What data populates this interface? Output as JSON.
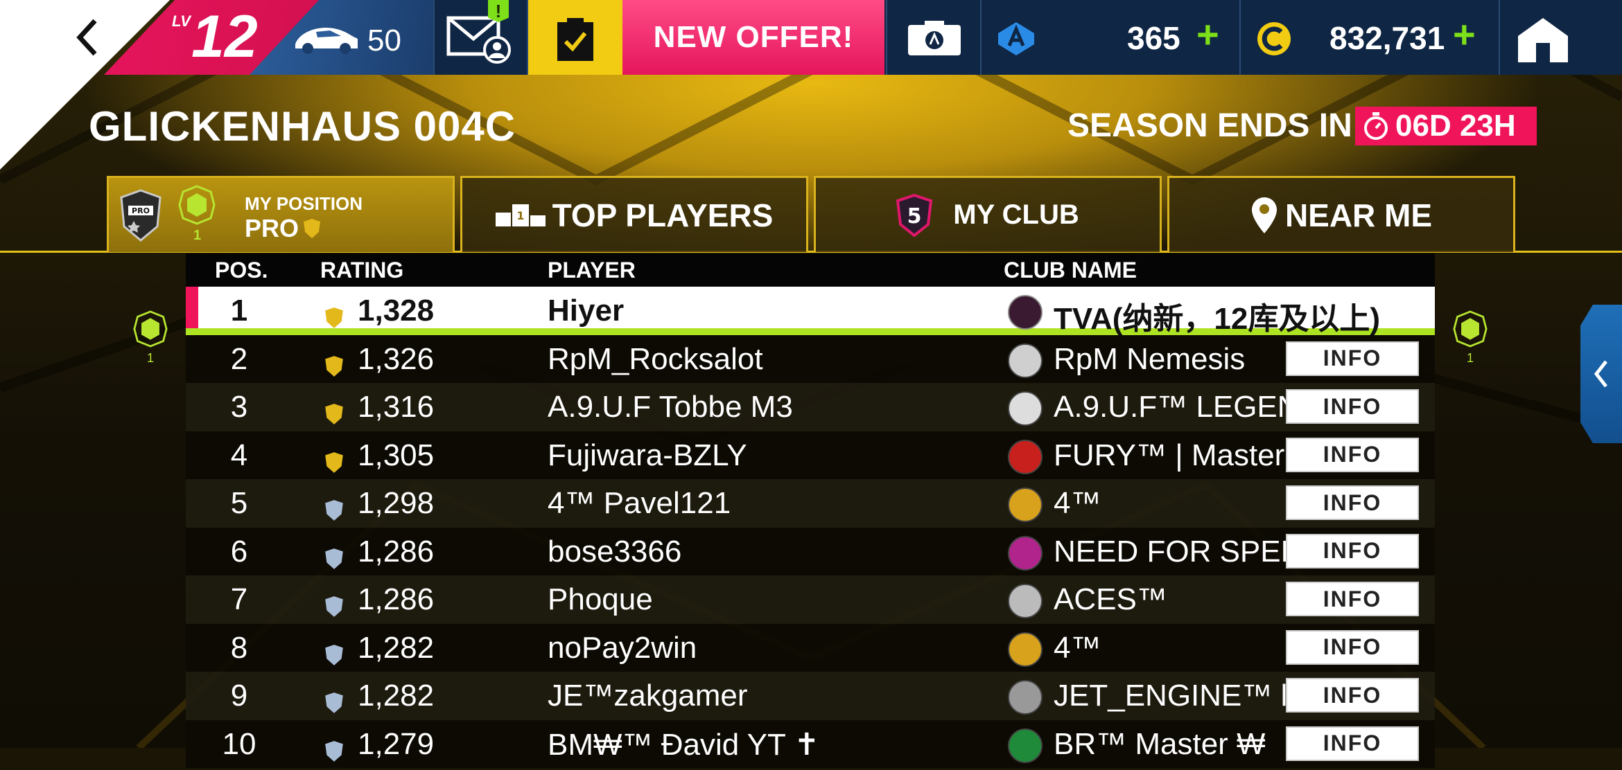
{
  "topbar": {
    "level_label": "LV",
    "level": "12",
    "cars_count": "50",
    "new_offer": "NEW OFFER!",
    "tokens": "365",
    "credits": "832,731",
    "mail_badge": "!"
  },
  "header": {
    "title": "GLICKENHAUS 004C",
    "season_label": "SEASON ENDS IN",
    "season_timer": "06D 23H"
  },
  "tabs": {
    "my_position_label": "MY POSITION",
    "my_position_value": "PRO",
    "my_rank_small": "1",
    "top_players": "TOP PLAYERS",
    "my_club": "MY CLUB",
    "near_me": "NEAR ME"
  },
  "table": {
    "headers": {
      "pos": "POS.",
      "rating": "RATING",
      "player": "PLAYER",
      "club": "CLUB NAME"
    },
    "info_label": "INFO",
    "side_rank": "1",
    "rows": [
      {
        "pos": "1",
        "rating": "1,328",
        "player": "Hiyer",
        "club": "TVA(纳新，12库及以上)",
        "shield": "gold"
      },
      {
        "pos": "2",
        "rating": "1,326",
        "player": "RpM_Rocksalot",
        "club": "RpM Nemesis",
        "shield": "gold"
      },
      {
        "pos": "3",
        "rating": "1,316",
        "player": "A.9.U.F Tobbe M3",
        "club": "A.9.U.F™ LEGEN",
        "shield": "gold"
      },
      {
        "pos": "4",
        "rating": "1,305",
        "player": "Fujiwara-BZLY",
        "club": "FURY™ | Master",
        "shield": "gold"
      },
      {
        "pos": "5",
        "rating": "1,298",
        "player": "4™ Pavel121",
        "club": "4™",
        "shield": "silver"
      },
      {
        "pos": "6",
        "rating": "1,286",
        "player": "bose3366",
        "club": "NEED FOR SPEE",
        "shield": "silver"
      },
      {
        "pos": "7",
        "rating": "1,286",
        "player": "Phoque",
        "club": "ACES™",
        "shield": "silver"
      },
      {
        "pos": "8",
        "rating": "1,282",
        "player": "noPay2win",
        "club": "4™",
        "shield": "silver"
      },
      {
        "pos": "9",
        "rating": "1,282",
        "player": "JE™zakgamer",
        "club": "JET_ENGINE™ ll",
        "shield": "silver"
      },
      {
        "pos": "10",
        "rating": "1,279",
        "player": "BM₩™ Đavid YT ✝",
        "club": "BR™ Master ₩",
        "shield": "silver"
      }
    ]
  },
  "colors": {
    "accent_pink": "#f0145a",
    "accent_green": "#7ee018",
    "gold": "#e6c01b",
    "panel_blue": "#0f2644"
  }
}
